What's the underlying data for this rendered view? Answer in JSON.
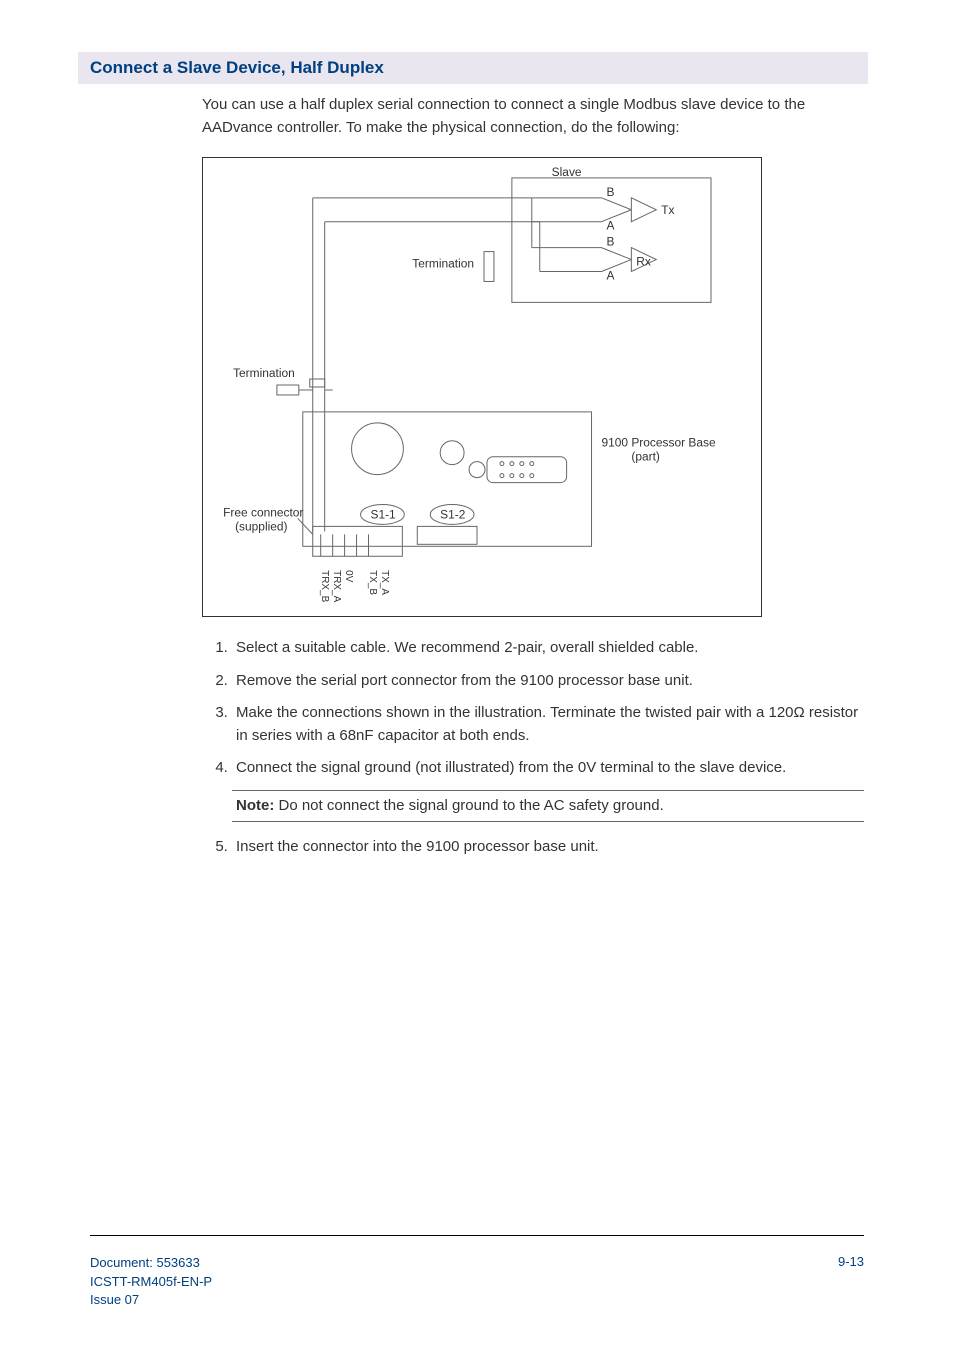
{
  "section_heading": "Connect a Slave Device, Half Duplex",
  "intro": "You can use a half duplex serial connection to connect a single Modbus slave device to the AADvance controller. To make the physical connection, do the following:",
  "figure": {
    "labels": {
      "slave": "Slave",
      "tx": "Tx",
      "rx": "Rx",
      "b1": "B",
      "a1": "A",
      "b2": "B",
      "a2": "A",
      "termination_left": "Termination",
      "termination_right": "Termination",
      "processor_base": "9100 Processor Base",
      "processor_base2": "(part)",
      "s11": "S1-1",
      "s12": "S1-2",
      "free_connector": "Free connector",
      "free_connector2": "(supplied)",
      "pin_trx_b": "TRX_B",
      "pin_trx_a": "TRX_A",
      "pin_0v": "0V",
      "pin_tx_b": "TX_B",
      "pin_tx_a": "TX_A"
    }
  },
  "steps": {
    "s1": "Select a suitable cable. We recommend 2-pair, overall shielded cable.",
    "s2": "Remove the serial port connector from the 9100 processor base unit.",
    "s3": "Make the connections shown in the illustration. Terminate the twisted pair with a 120Ω resistor in series with a 68nF capacitor at both ends.",
    "s4": "Connect the signal ground (not illustrated) from the 0V terminal to the slave device.",
    "note_label": "Note:",
    "note_text": " Do not connect the signal ground to the AC safety ground.",
    "s5": "Insert the connector into the 9100 processor base unit."
  },
  "footer": {
    "doc": "Document: 553633",
    "code": "ICSTT-RM405f-EN-P",
    "issue": " Issue 07",
    "page": "9-13"
  }
}
